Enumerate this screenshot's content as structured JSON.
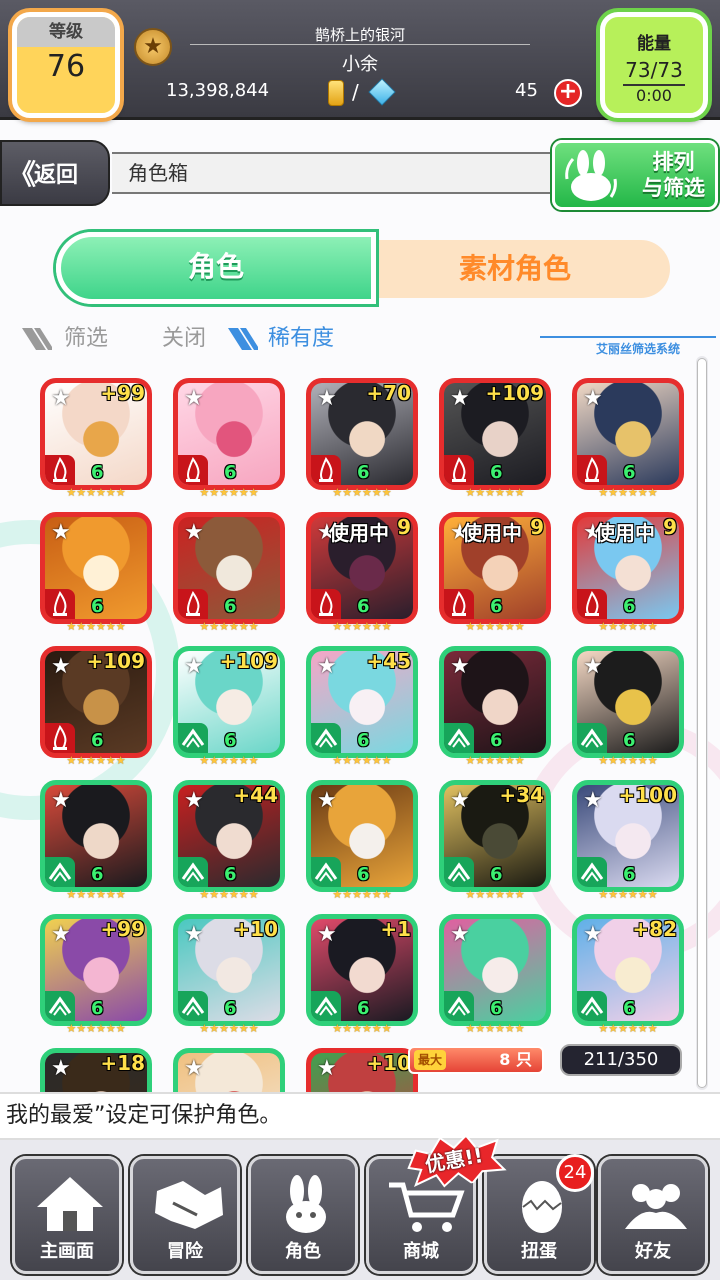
{
  "header": {
    "level_label": "等级",
    "level_value": "76",
    "title": "鹊桥上的银河",
    "player_name": "小余",
    "coins": "13,398,844",
    "slash": "/",
    "gems": "45",
    "energy_label": "能量",
    "energy_value": "73/73",
    "energy_timer": "0:00"
  },
  "nav": {
    "back_label": "返回",
    "breadcrumb": "角色箱",
    "sort_line1": "排列",
    "sort_line2": "与筛选"
  },
  "tabs": {
    "characters": "角色",
    "materials": "素材角色"
  },
  "filter": {
    "filter_label": "筛选",
    "filter_state": "关闭",
    "sort_label": "稀有度",
    "system_label": "艾丽丝筛选系统"
  },
  "colors": {
    "red_frame": "#e62d2d",
    "green_frame": "#2fd07a",
    "accent_blue": "#3d8fe0"
  },
  "cards": [
    {
      "frame": "red",
      "plus": "+99",
      "in_use": "",
      "level": "6",
      "element": "fire-icon",
      "palette": [
        "#f4d8c8",
        "#e8a64a",
        "#fff"
      ]
    },
    {
      "frame": "red",
      "plus": "",
      "in_use": "",
      "level": "6",
      "element": "fire-icon",
      "palette": [
        "#f7a6c0",
        "#e2557d",
        "#ffd7e6"
      ]
    },
    {
      "frame": "red",
      "plus": "+70",
      "in_use": "",
      "level": "6",
      "element": "fire-icon",
      "palette": [
        "#2a2a30",
        "#f0d8c4",
        "#b0b0b8"
      ]
    },
    {
      "frame": "red",
      "plus": "+109",
      "in_use": "",
      "level": "6",
      "element": "fire-icon",
      "palette": [
        "#1c1c22",
        "#e8d2c8",
        "#555"
      ]
    },
    {
      "frame": "red",
      "plus": "",
      "in_use": "",
      "level": "6",
      "element": "fire-icon",
      "palette": [
        "#2b3a5c",
        "#e7c26a",
        "#f0d8c4"
      ]
    },
    {
      "frame": "red",
      "plus": "",
      "in_use": "",
      "level": "6",
      "element": "fire-icon",
      "palette": [
        "#f09a2e",
        "#fff1d6",
        "#c85e14"
      ]
    },
    {
      "frame": "red",
      "plus": "",
      "in_use": "",
      "level": "6",
      "element": "fire-icon",
      "palette": [
        "#8c5a3a",
        "#f0e8dc",
        "#c22"
      ]
    },
    {
      "frame": "red",
      "plus": "9",
      "in_use": "使用中",
      "level": "6",
      "element": "fire-icon",
      "palette": [
        "#2a1e2c",
        "#6a2a4a",
        "#d03a3a"
      ]
    },
    {
      "frame": "red",
      "plus": "9",
      "in_use": "使用中",
      "level": "6",
      "element": "fire-icon",
      "palette": [
        "#a0402a",
        "#f4d2b8",
        "#ffb03a"
      ]
    },
    {
      "frame": "red",
      "plus": "9",
      "in_use": "使用中",
      "level": "6",
      "element": "fire-icon",
      "palette": [
        "#7ac8f0",
        "#f4e0d4",
        "#e23a3a"
      ]
    },
    {
      "frame": "red",
      "plus": "+109",
      "in_use": "",
      "level": "6",
      "element": "fire-icon",
      "palette": [
        "#5a3a24",
        "#c89248",
        "#2a1a10"
      ]
    },
    {
      "frame": "green",
      "plus": "+109",
      "in_use": "",
      "level": "6",
      "element": "wind-icon",
      "palette": [
        "#6ad6c8",
        "#f6ece4",
        "#fff"
      ]
    },
    {
      "frame": "green",
      "plus": "+45",
      "in_use": "",
      "level": "6",
      "element": "wind-icon",
      "palette": [
        "#7ad8e0",
        "#f8f0f4",
        "#f4a6c6"
      ]
    },
    {
      "frame": "green",
      "plus": "",
      "in_use": "",
      "level": "6",
      "element": "wind-icon",
      "palette": [
        "#1e1418",
        "#f0d6c8",
        "#7a2a3a"
      ]
    },
    {
      "frame": "green",
      "plus": "",
      "in_use": "",
      "level": "6",
      "element": "wind-icon",
      "palette": [
        "#1c1c1c",
        "#e8c24a",
        "#f4d8c4"
      ]
    },
    {
      "frame": "green",
      "plus": "",
      "in_use": "",
      "level": "6",
      "element": "wind-icon",
      "palette": [
        "#1a1a1e",
        "#eed8c8",
        "#d84a3a"
      ]
    },
    {
      "frame": "green",
      "plus": "+44",
      "in_use": "",
      "level": "6",
      "element": "wind-icon",
      "palette": [
        "#2a2a2e",
        "#f0dcd0",
        "#c82020"
      ]
    },
    {
      "frame": "green",
      "plus": "",
      "in_use": "",
      "level": "6",
      "element": "wind-icon",
      "palette": [
        "#e8a43a",
        "#f4f0ec",
        "#6a3a14"
      ]
    },
    {
      "frame": "green",
      "plus": "+34",
      "in_use": "",
      "level": "6",
      "element": "wind-icon",
      "palette": [
        "#1a1a12",
        "#4a4a36",
        "#e0c060"
      ]
    },
    {
      "frame": "green",
      "plus": "+100",
      "in_use": "",
      "level": "6",
      "element": "wind-icon",
      "palette": [
        "#dadaf0",
        "#f4e8f0",
        "#3a4a7a"
      ]
    },
    {
      "frame": "green",
      "plus": "+99",
      "in_use": "",
      "level": "6",
      "element": "wind-icon",
      "palette": [
        "#8a4aa8",
        "#f4b6d2",
        "#f0d050"
      ]
    },
    {
      "frame": "green",
      "plus": "+10",
      "in_use": "",
      "level": "6",
      "element": "wind-icon",
      "palette": [
        "#dcdce6",
        "#f2e8e2",
        "#4ac8c0"
      ]
    },
    {
      "frame": "green",
      "plus": "+1",
      "in_use": "",
      "level": "6",
      "element": "wind-icon",
      "palette": [
        "#1a1a22",
        "#f2dad0",
        "#e04a6a"
      ]
    },
    {
      "frame": "green",
      "plus": "",
      "in_use": "",
      "level": "6",
      "element": "wind-icon",
      "palette": [
        "#4ad0a0",
        "#f6ecea",
        "#e060a0"
      ]
    },
    {
      "frame": "green",
      "plus": "+82",
      "in_use": "",
      "level": "6",
      "element": "wind-icon",
      "palette": [
        "#f0d0e8",
        "#f8ecd0",
        "#60b0e8"
      ]
    },
    {
      "frame": "green",
      "plus": "+18",
      "in_use": "",
      "level": "",
      "element": "",
      "palette": [
        "#3a2a1a",
        "#f0d4c0",
        "#2a2a2a"
      ]
    },
    {
      "frame": "green",
      "plus": "",
      "in_use": "",
      "level": "",
      "element": "",
      "palette": [
        "#f4e8d8",
        "#d04040",
        "#f0c080"
      ]
    },
    {
      "frame": "red",
      "plus": "+10",
      "in_use": "",
      "level": "",
      "element": "",
      "palette": [
        "#c04040",
        "#f0d0b0",
        "#40a050"
      ]
    }
  ],
  "stars_text": "★★★★★★",
  "fav_star": "★",
  "counters": {
    "max_tag": "最大",
    "max_value": "8 只",
    "box_count": "211/350"
  },
  "hint": "我的最爱”设定可保护角色。",
  "bottom_nav": [
    {
      "label": "主画面",
      "icon": "home-icon"
    },
    {
      "label": "冒险",
      "icon": "handshake-icon"
    },
    {
      "label": "角色",
      "icon": "rabbit-icon"
    },
    {
      "label": "商城",
      "icon": "cart-icon"
    },
    {
      "label": "扭蛋",
      "icon": "egg-icon"
    },
    {
      "label": "好友",
      "icon": "friends-icon"
    }
  ],
  "sale_label": "优惠!!",
  "gacha_badge": "24"
}
